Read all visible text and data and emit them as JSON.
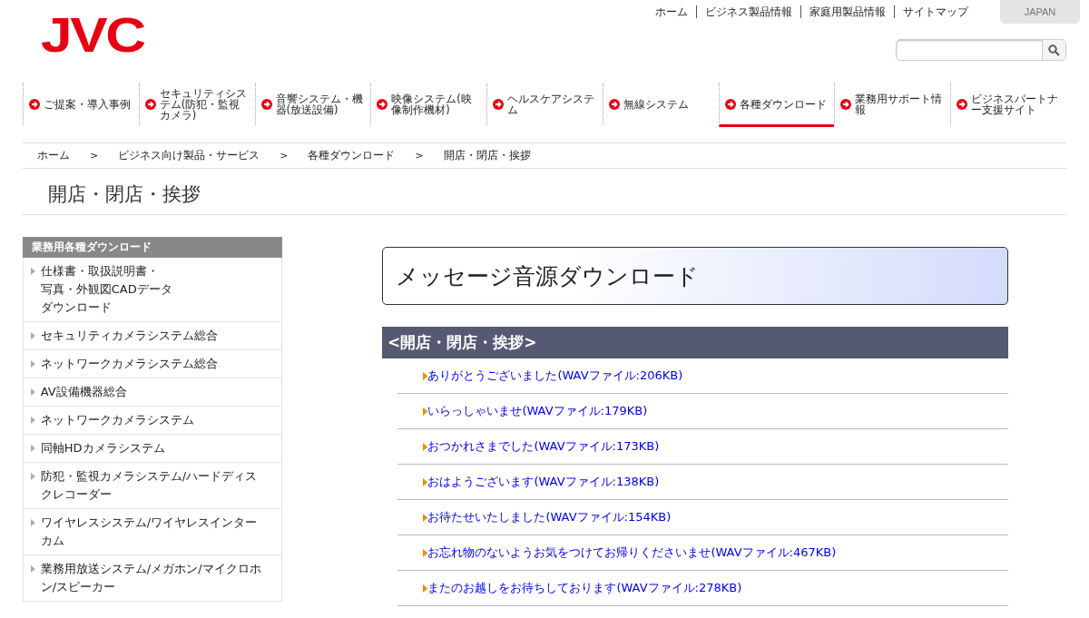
{
  "logo": "JVC",
  "top_links": [
    "ホーム",
    "ビジネス製品情報",
    "家庭用製品情報",
    "サイトマップ"
  ],
  "region_button": "JAPAN",
  "nav": [
    {
      "label": "ご提案・導入事例",
      "selected": false
    },
    {
      "label": "セキュリティシステム(防犯・監視カメラ)",
      "selected": false
    },
    {
      "label": "音響システム・機器(放送設備)",
      "selected": false
    },
    {
      "label": "映像システム(映像制作機材)",
      "selected": false
    },
    {
      "label": "ヘルスケアシステム",
      "selected": false
    },
    {
      "label": "無線システム",
      "selected": false
    },
    {
      "label": "各種ダウンロード",
      "selected": true
    },
    {
      "label": "業務用サポート情報",
      "selected": false
    },
    {
      "label": "ビジネスパートナー支援サイト",
      "selected": false
    }
  ],
  "breadcrumb": [
    {
      "label": "ホーム",
      "separator": ">"
    },
    {
      "label": "ビジネス向け製品・サービス",
      "separator": ">"
    },
    {
      "label": "各種ダウンロード",
      "separator": ">"
    },
    {
      "label": "開店・閉店・挨拶"
    }
  ],
  "page_title": "開店・閉店・挨拶",
  "sidebar": {
    "title": "業務用各種ダウンロード",
    "items": [
      [
        "仕様書・取扱説明書・",
        "写真・外観図CADデータ",
        "ダウンロード"
      ],
      "セキュリティカメラシステム総合",
      "ネットワークカメラシステム総合",
      "AV設備機器総合",
      "ネットワークカメラシステム",
      "同軸HDカメラシステム",
      "防犯・監視カメラシステム/ハードディスクレコーダー",
      "ワイヤレスシステム/ワイヤレスインターカム",
      "業務用放送システム/メガホン/マイクロホン/スピーカー"
    ]
  },
  "main": {
    "heading": "メッセージ音源ダウンロード",
    "section": "<開店・閉店・挨拶>",
    "downloads": [
      "ありがとうございました(WAVファイル:206KB)",
      "いらっしゃいませ(WAVファイル:179KB)",
      "おつかれさまでした(WAVファイル:173KB)",
      "おはようございます(WAVファイル:138KB)",
      "お待たせいたしました(WAVファイル:154KB)",
      "お忘れ物のないようお気をつけてお帰りくださいませ(WAVファイル:467KB)",
      "またのお越しをお待ちしております(WAVファイル:278KB)"
    ]
  }
}
